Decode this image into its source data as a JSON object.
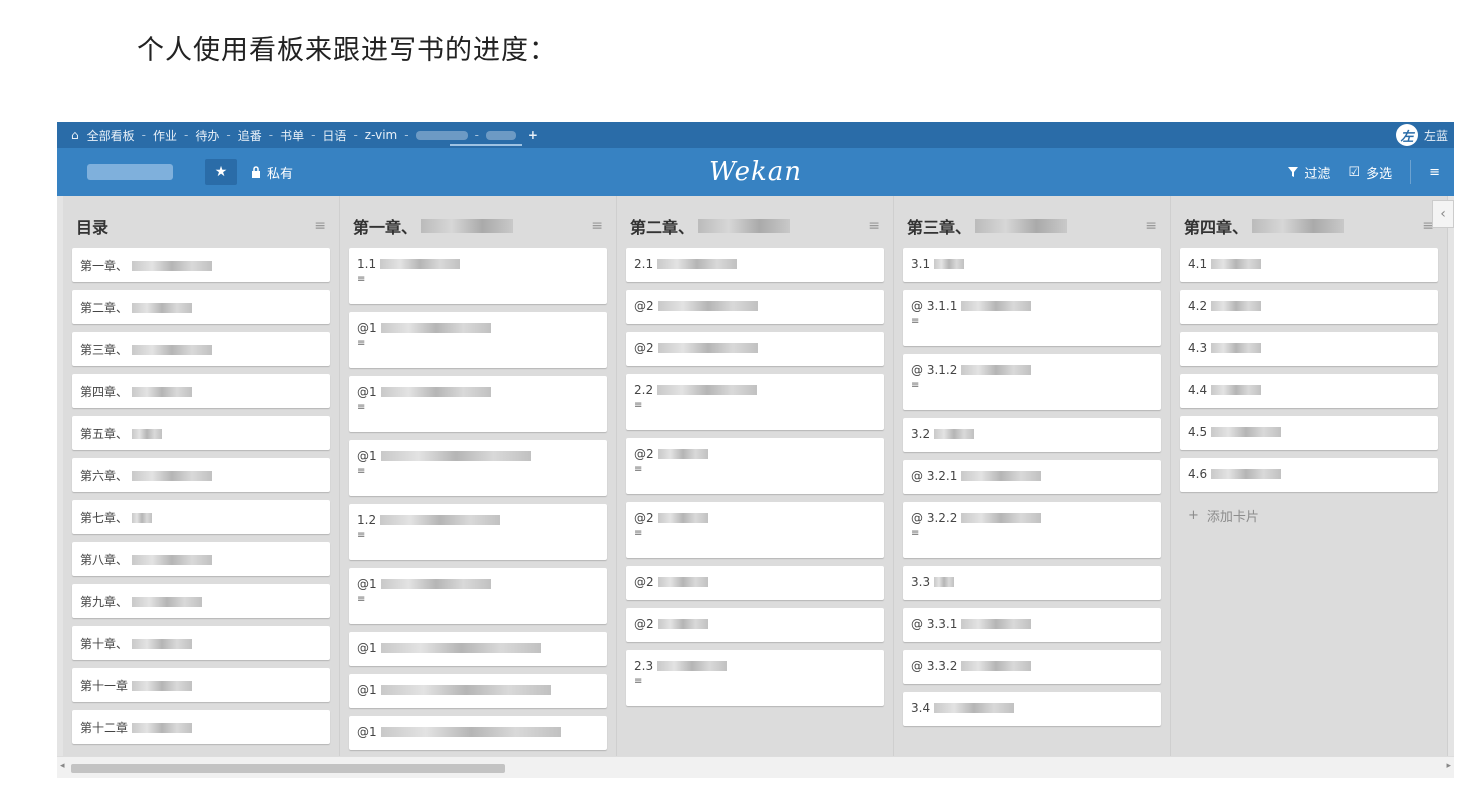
{
  "caption": "个人使用看板来跟进写书的进度：",
  "topbar": {
    "home_icon": "home-icon",
    "crumbs": [
      "全部看板",
      "作业",
      "待办",
      "追番",
      "书单",
      "日语",
      "z-vim"
    ],
    "separator": "-",
    "plus": "+",
    "user_name": "左蓝",
    "avatar_text": "左"
  },
  "header": {
    "star_icon": "★",
    "private_icon": "lock-icon",
    "private_label": "私有",
    "logo": "Wekan",
    "filter_label": "过滤",
    "multiselect_label": "多选",
    "menu_icon": "≡"
  },
  "lists": [
    {
      "title": "目录",
      "cards": [
        {
          "text": "第一章、",
          "blur": 80,
          "desc": false
        },
        {
          "text": "第二章、",
          "blur": 60,
          "desc": false
        },
        {
          "text": "第三章、",
          "blur": 80,
          "desc": false
        },
        {
          "text": "第四章、",
          "blur": 60,
          "desc": false
        },
        {
          "text": "第五章、",
          "blur": 30,
          "desc": false
        },
        {
          "text": "第六章、",
          "blur": 80,
          "desc": false
        },
        {
          "text": "第七章、",
          "blur": 20,
          "desc": false
        },
        {
          "text": "第八章、",
          "blur": 80,
          "desc": false
        },
        {
          "text": "第九章、",
          "blur": 70,
          "desc": false
        },
        {
          "text": "第十章、",
          "blur": 60,
          "desc": false
        },
        {
          "text": "第十一章",
          "blur": 60,
          "desc": false
        },
        {
          "text": "第十二章",
          "blur": 60,
          "desc": false
        }
      ]
    },
    {
      "title": "第一章、",
      "cards": [
        {
          "text": "1.1",
          "blur": 80,
          "desc": true
        },
        {
          "text": "@1",
          "blur": 110,
          "desc": true
        },
        {
          "text": "@1",
          "blur": 110,
          "desc": true
        },
        {
          "text": "@1",
          "blur": 150,
          "desc": true
        },
        {
          "text": "1.2",
          "blur": 120,
          "desc": true
        },
        {
          "text": "@1",
          "blur": 110,
          "desc": true
        },
        {
          "text": "@1",
          "blur": 160,
          "desc": false
        },
        {
          "text": "@1",
          "blur": 170,
          "desc": false
        },
        {
          "text": "@1",
          "blur": 180,
          "desc": false
        }
      ]
    },
    {
      "title": "第二章、",
      "cards": [
        {
          "text": "2.1",
          "blur": 80,
          "desc": false
        },
        {
          "text": "@2",
          "blur": 100,
          "desc": false
        },
        {
          "text": "@2",
          "blur": 100,
          "desc": false
        },
        {
          "text": "2.2",
          "blur": 100,
          "desc": true
        },
        {
          "text": "@2",
          "blur": 50,
          "desc": true
        },
        {
          "text": "@2",
          "blur": 50,
          "desc": true
        },
        {
          "text": "@2",
          "blur": 50,
          "desc": false
        },
        {
          "text": "@2",
          "blur": 50,
          "desc": false
        },
        {
          "text": "2.3",
          "blur": 70,
          "desc": true
        }
      ]
    },
    {
      "title": "第三章、",
      "cards": [
        {
          "text": "3.1",
          "blur": 30,
          "desc": false
        },
        {
          "text": "@ 3.1.1",
          "blur": 70,
          "desc": true
        },
        {
          "text": "@ 3.1.2",
          "blur": 70,
          "desc": true
        },
        {
          "text": "3.2",
          "blur": 40,
          "desc": false
        },
        {
          "text": "@ 3.2.1",
          "blur": 80,
          "desc": false
        },
        {
          "text": "@ 3.2.2",
          "blur": 80,
          "desc": true
        },
        {
          "text": "3.3",
          "blur": 20,
          "desc": false
        },
        {
          "text": "@ 3.3.1",
          "blur": 70,
          "desc": false
        },
        {
          "text": "@ 3.3.2",
          "blur": 70,
          "desc": false
        },
        {
          "text": "3.4",
          "blur": 80,
          "desc": false
        }
      ]
    },
    {
      "title": "第四章、",
      "cards": [
        {
          "text": "4.1",
          "blur": 50,
          "desc": false
        },
        {
          "text": "4.2",
          "blur": 50,
          "desc": false
        },
        {
          "text": "4.3",
          "blur": 50,
          "desc": false
        },
        {
          "text": "4.4",
          "blur": 50,
          "desc": false
        },
        {
          "text": "4.5",
          "blur": 70,
          "desc": false
        },
        {
          "text": "4.6",
          "blur": 70,
          "desc": false
        }
      ],
      "add_card": "添加卡片"
    }
  ]
}
